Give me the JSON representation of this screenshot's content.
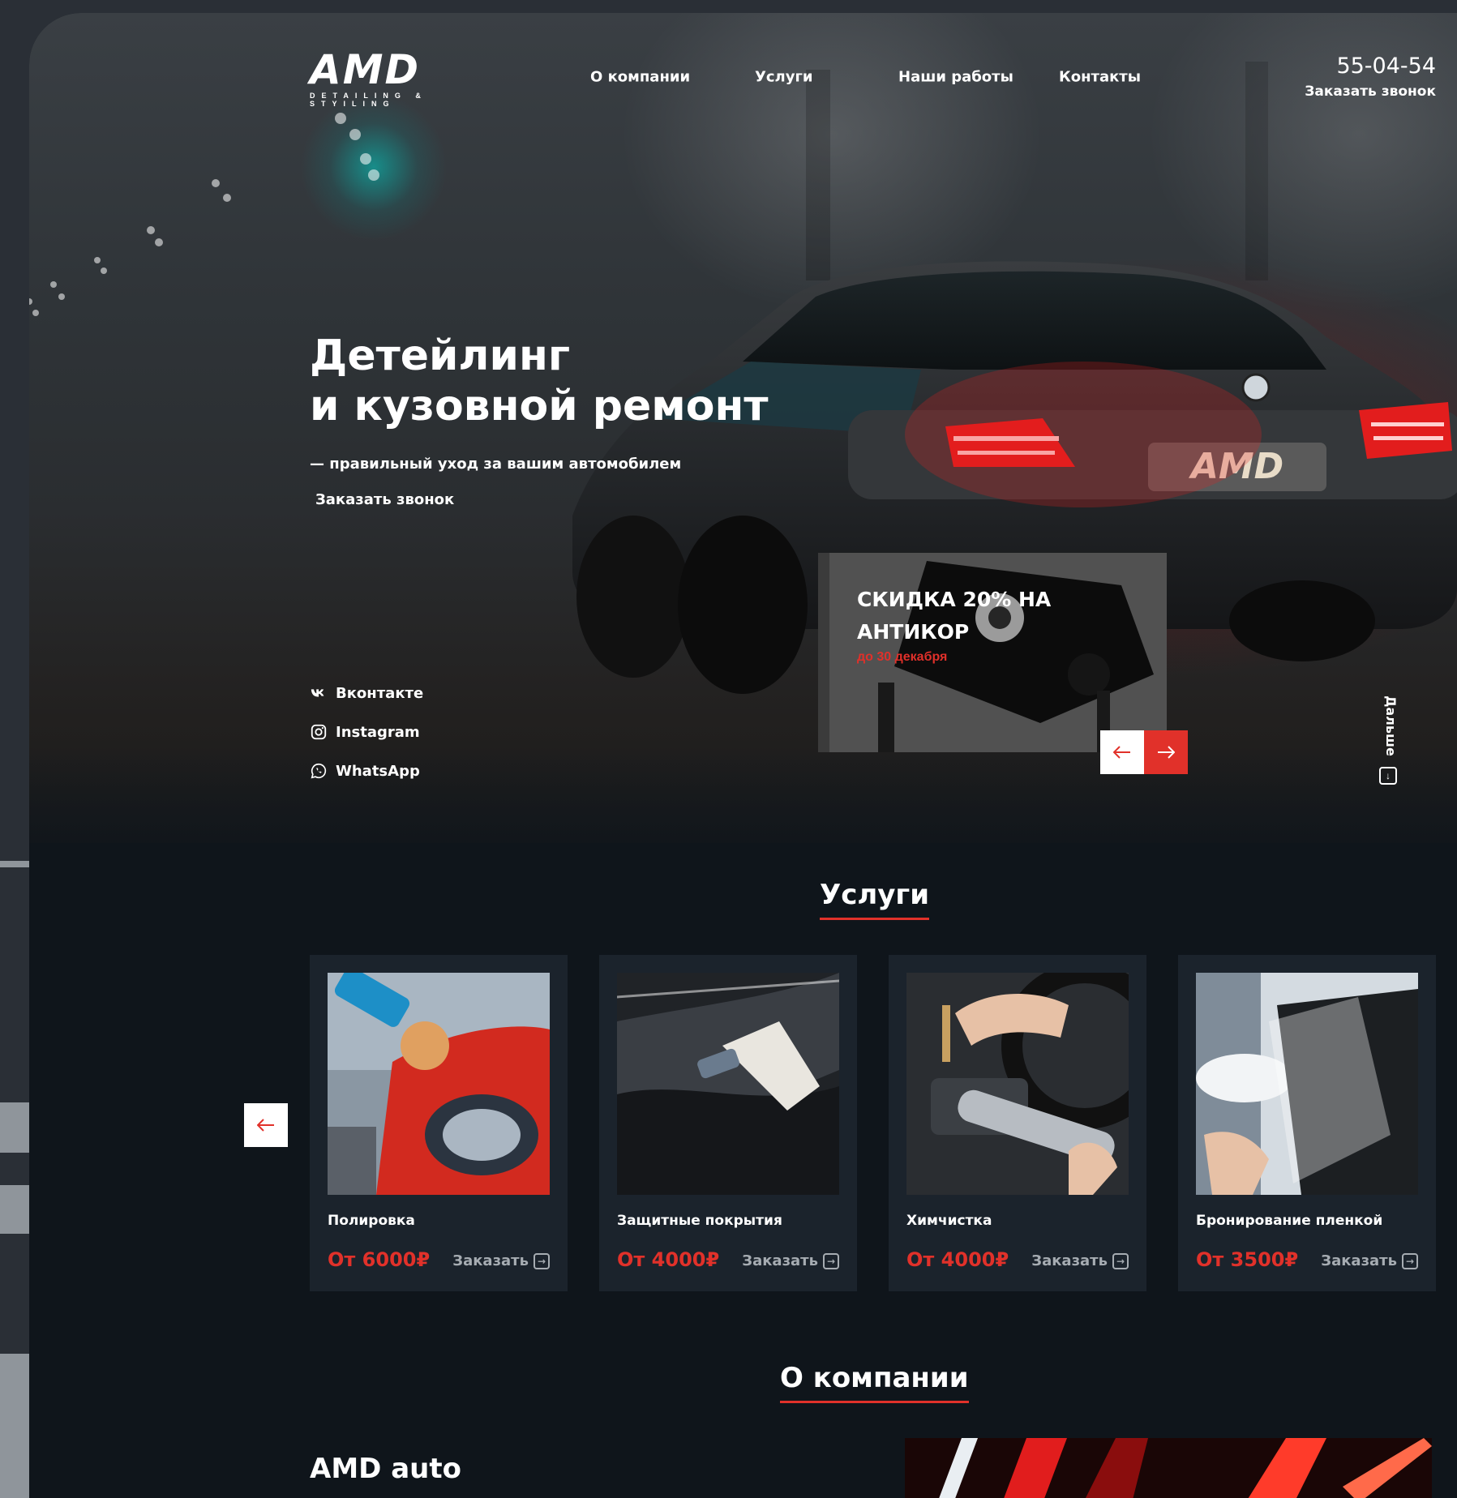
{
  "brand": {
    "logo_text": "AMD",
    "logo_tagline": "DETAILING & STYILING"
  },
  "nav": {
    "items": [
      {
        "label": "О компании"
      },
      {
        "label": "Услуги"
      },
      {
        "label": "Наши работы"
      },
      {
        "label": "Контакты"
      }
    ]
  },
  "contact": {
    "phone": "55-04-54",
    "callback_label": "Заказать звонок"
  },
  "hero": {
    "title_line1": "Детейлинг",
    "title_line2": "и кузовной ремонт",
    "subtitle": "— правильный уход за вашим автомобилем",
    "cta_label": "Заказать звонок",
    "plate_text": "AMD"
  },
  "socials": [
    {
      "label": "Вконтакте",
      "icon": "vk-icon"
    },
    {
      "label": "Instagram",
      "icon": "instagram-icon"
    },
    {
      "label": "WhatsApp",
      "icon": "whatsapp-icon"
    }
  ],
  "promo": {
    "title": "СКИДКА 20% НА АНТИКОР",
    "date": "до 30 декабря"
  },
  "scroll_hint": {
    "label": "Дальше"
  },
  "services": {
    "title": "Услуги",
    "order_label": "Заказать",
    "items": [
      {
        "name": "Полировка",
        "price": "От 6000₽"
      },
      {
        "name": "Защитные покрытия",
        "price": "От 4000₽"
      },
      {
        "name": "Химчистка",
        "price": "От 4000₽"
      },
      {
        "name": "Бронирование пленкой",
        "price": "От 3500₽"
      }
    ]
  },
  "about": {
    "title": "О компании",
    "brand_name": "AMD auto"
  },
  "colors": {
    "accent": "#e1312a",
    "background": "#0f151b",
    "card": "#1b232c",
    "muted_text": "#a6acb2"
  }
}
